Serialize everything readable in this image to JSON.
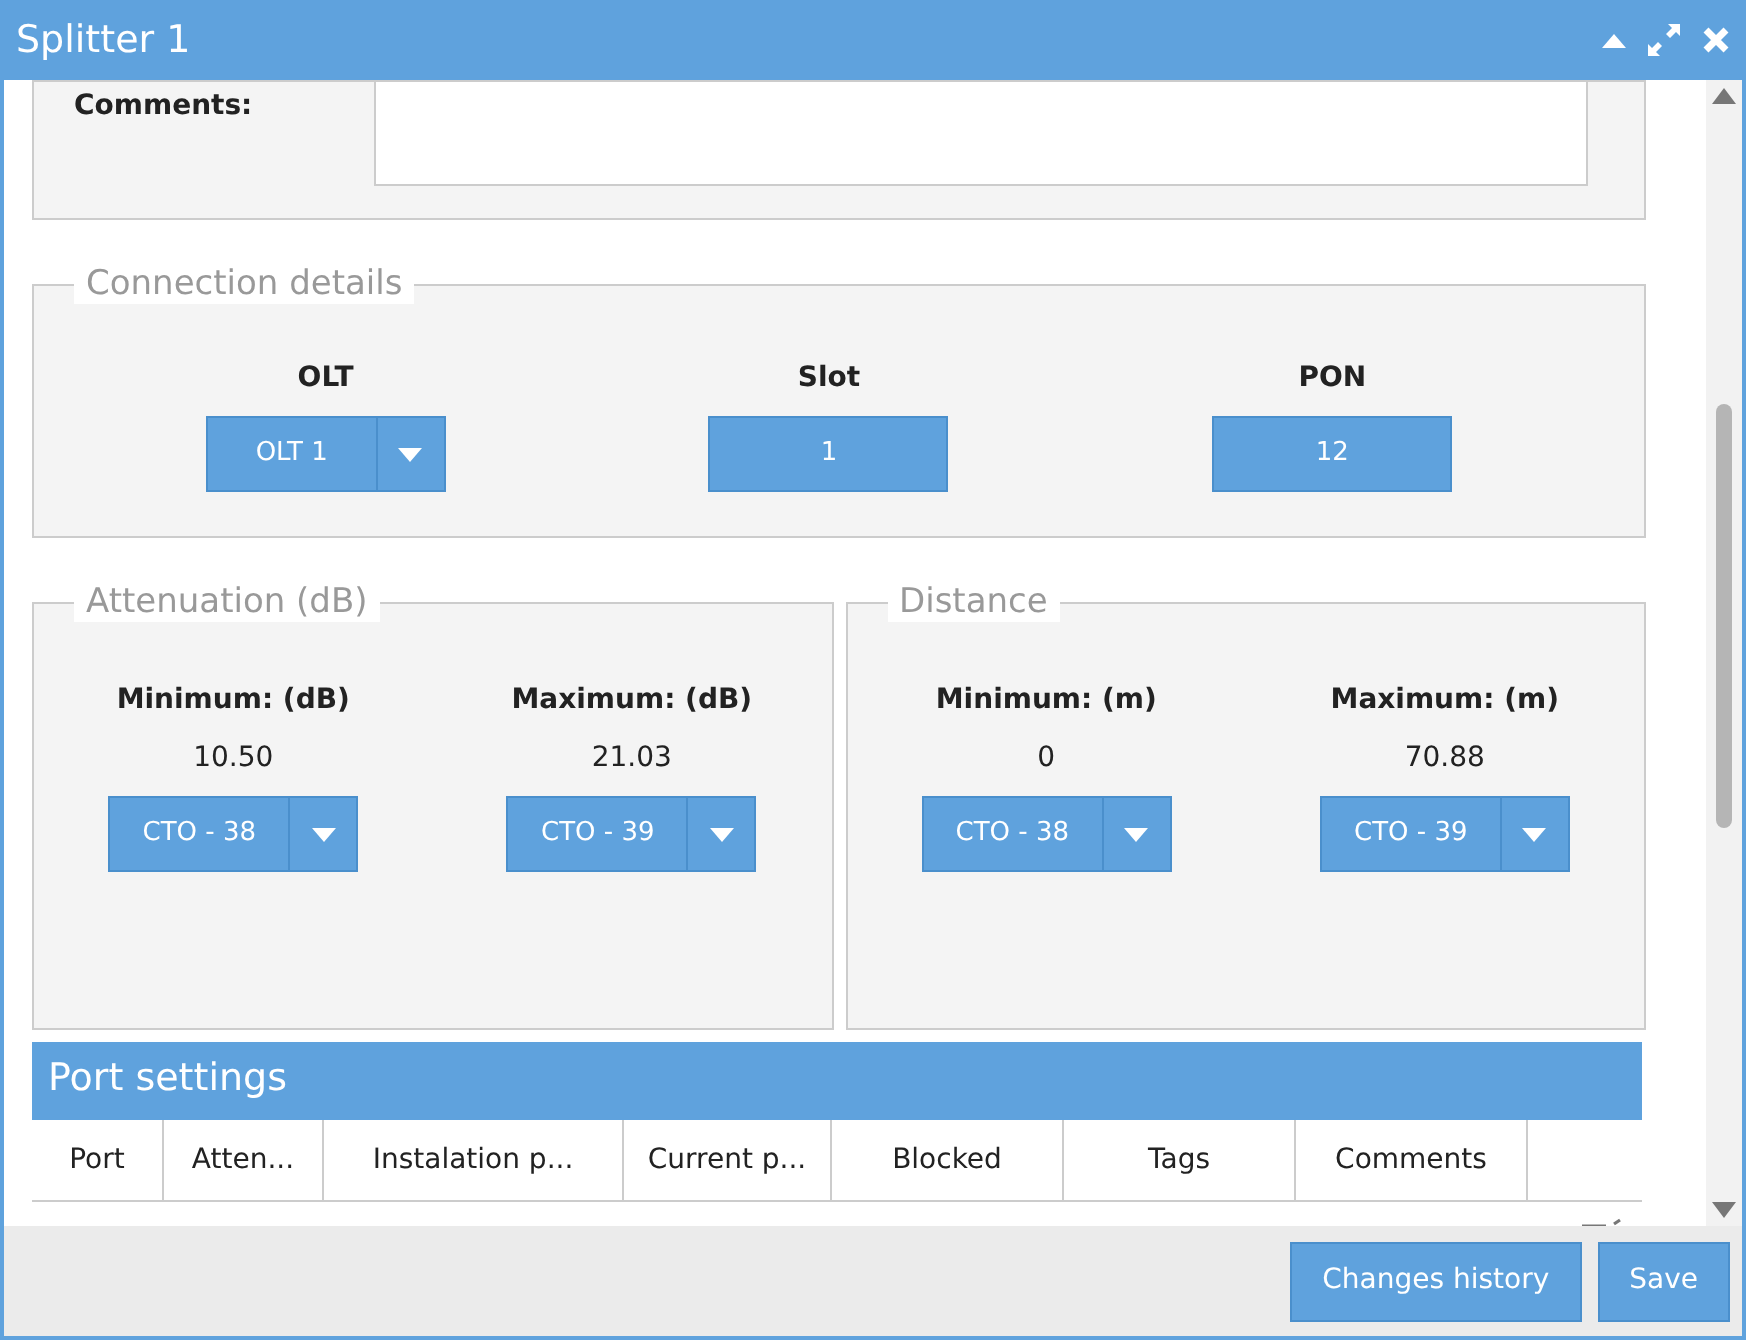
{
  "window": {
    "title": "Splitter 1"
  },
  "comments": {
    "label": "Comments:"
  },
  "connection": {
    "legend": "Connection details",
    "fields": [
      {
        "label": "OLT",
        "kind": "dropdown",
        "value": "OLT 1"
      },
      {
        "label": "Slot",
        "kind": "value",
        "value": "1"
      },
      {
        "label": "PON",
        "kind": "value",
        "value": "12"
      }
    ]
  },
  "panels": [
    {
      "legend": "Attenuation (dB)",
      "fields": [
        {
          "label": "Minimum: (dB)",
          "reading": "10.50",
          "kind": "dropdown",
          "value": "CTO - 38"
        },
        {
          "label": "Maximum: (dB)",
          "reading": "21.03",
          "kind": "dropdown",
          "value": "CTO - 39"
        }
      ]
    },
    {
      "legend": "Distance",
      "fields": [
        {
          "label": "Minimum: (m)",
          "reading": "0",
          "kind": "dropdown",
          "value": "CTO - 38"
        },
        {
          "label": "Maximum: (m)",
          "reading": "70.88",
          "kind": "dropdown",
          "value": "CTO - 39"
        }
      ]
    }
  ],
  "port_settings": {
    "title": "Port settings",
    "columns": [
      "Port",
      "Atten...",
      "Instalation p...",
      "Current p...",
      "Blocked",
      "Tags",
      "Comments"
    ]
  },
  "buttons": [
    "Changes history",
    "Save"
  ]
}
